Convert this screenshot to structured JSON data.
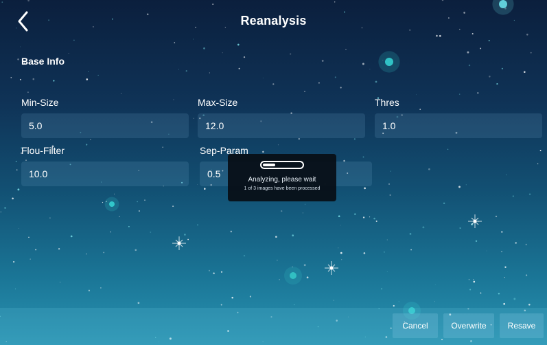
{
  "header": {
    "title": "Reanalysis",
    "back_icon": "chevron-left-icon"
  },
  "base_info": {
    "section_title": "Base Info",
    "fields": [
      {
        "label": "Min-Size",
        "value": "5.0"
      },
      {
        "label": "Max-Size",
        "value": "12.0"
      },
      {
        "label": "Thres",
        "value": "1.0"
      },
      {
        "label": "Flou-Filter",
        "value": "10.0"
      },
      {
        "label": "Sep-Param",
        "value": "0.5"
      }
    ]
  },
  "dialog": {
    "message": "Analyzing, please wait",
    "detail": "1 of 3 images have been processed",
    "progress_fraction": 0.33
  },
  "actions": {
    "cancel": "Cancel",
    "overwrite": "Overwrite",
    "resave": "Resave"
  },
  "colors": {
    "background_top": "#0b1f3d",
    "background_bottom": "#2a94b2",
    "dialog_bg": "#080e16"
  }
}
